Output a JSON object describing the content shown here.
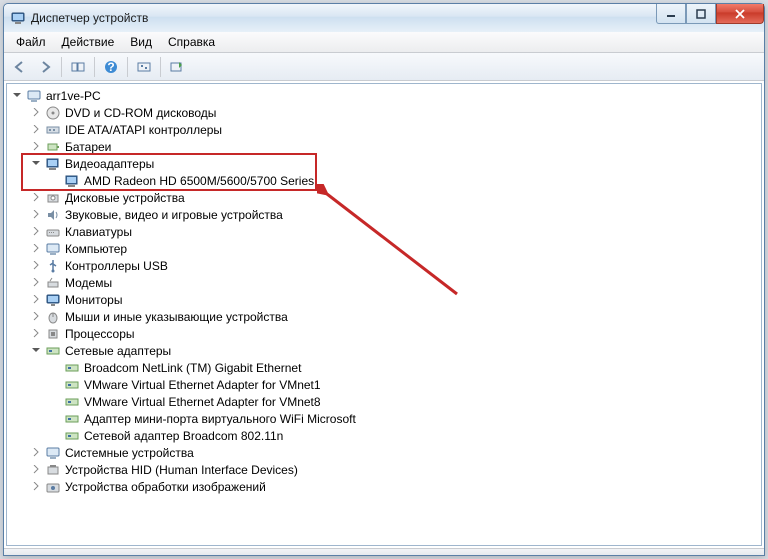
{
  "window": {
    "title": "Диспетчер устройств"
  },
  "menu": {
    "file": "Файл",
    "action": "Действие",
    "view": "Вид",
    "help": "Справка"
  },
  "tree": {
    "root": "arr1ve-PC",
    "dvd": "DVD и CD-ROM дисководы",
    "ide": "IDE ATA/ATAPI контроллеры",
    "battery": "Батареи",
    "video": "Видеоадаптеры",
    "video_child": "AMD Radeon HD 6500M/5600/5700 Series",
    "disk": "Дисковые устройства",
    "sound": "Звуковые, видео и игровые устройства",
    "keyboard": "Клавиатуры",
    "computer": "Компьютер",
    "usb": "Контроллеры USB",
    "modem": "Модемы",
    "monitor": "Мониторы",
    "mouse": "Мыши и иные указывающие устройства",
    "cpu": "Процессоры",
    "net": "Сетевые адаптеры",
    "net0": "Broadcom NetLink (TM) Gigabit Ethernet",
    "net1": "VMware Virtual Ethernet Adapter for VMnet1",
    "net2": "VMware Virtual Ethernet Adapter for VMnet8",
    "net3": "Адаптер мини-порта виртуального WiFi Microsoft",
    "net4": "Сетевой адаптер Broadcom 802.11n",
    "system": "Системные устройства",
    "hid": "Устройства HID (Human Interface Devices)",
    "imaging": "Устройства обработки изображений"
  },
  "icons": {
    "pc": "computer-icon",
    "dvd": "disc-drive-icon",
    "ide": "controller-icon",
    "battery": "battery-icon",
    "video": "display-adapter-icon",
    "disk": "disk-drive-icon",
    "sound": "sound-icon",
    "keyboard": "keyboard-icon",
    "computer": "pc-icon",
    "usb": "usb-icon",
    "modem": "modem-icon",
    "monitor": "monitor-icon",
    "mouse": "mouse-icon",
    "cpu": "cpu-icon",
    "net": "network-icon",
    "system": "system-icon",
    "hid": "hid-icon",
    "imaging": "imaging-icon"
  }
}
